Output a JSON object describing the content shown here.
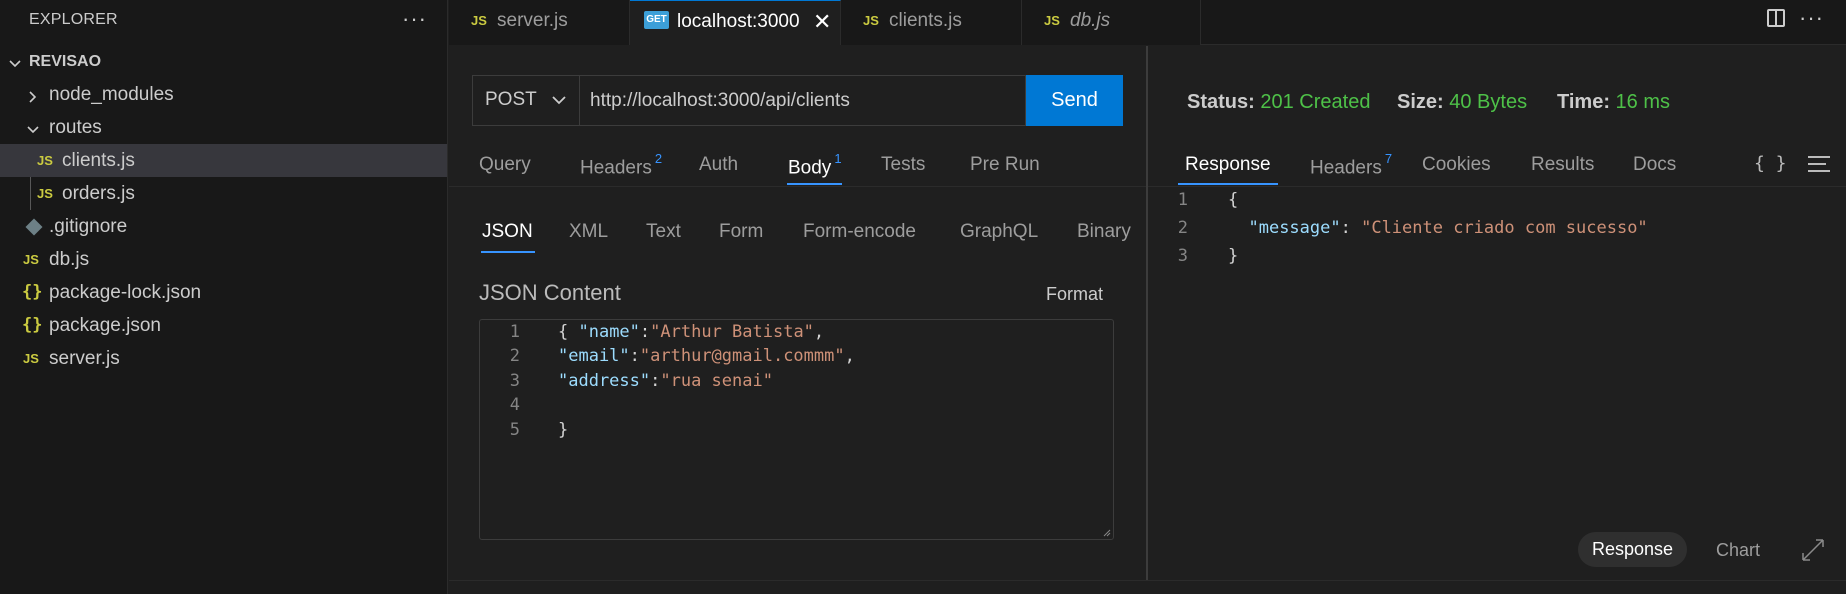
{
  "explorer": {
    "title": "EXPLORER",
    "more_label": "···",
    "root": "REVISAO",
    "items": [
      {
        "label": "node_modules",
        "icon": "chevron-right-icon"
      },
      {
        "label": "routes",
        "icon": "chevron-down-icon"
      },
      {
        "label": "clients.js",
        "icon": "js-icon"
      },
      {
        "label": "orders.js",
        "icon": "js-icon"
      },
      {
        "label": ".gitignore",
        "icon": "git-icon"
      },
      {
        "label": "db.js",
        "icon": "js-icon"
      },
      {
        "label": "package-lock.json",
        "icon": "json-braces-icon"
      },
      {
        "label": "package.json",
        "icon": "json-braces-icon"
      },
      {
        "label": "server.js",
        "icon": "js-icon"
      }
    ],
    "js_badge": "JS",
    "braces_badge": "{}"
  },
  "tabs": [
    {
      "label": "server.js",
      "badge": "JS"
    },
    {
      "label": "localhost:3000",
      "badge": "GET",
      "close": "✕"
    },
    {
      "label": "clients.js",
      "badge": "JS"
    },
    {
      "label": "db.js",
      "badge": "JS"
    }
  ],
  "tab_more": "···",
  "request": {
    "method": "POST",
    "url": "http://localhost:3000/api/clients",
    "send_label": "Send",
    "tabs": [
      {
        "label": "Query"
      },
      {
        "label": "Headers",
        "count": "2"
      },
      {
        "label": "Auth"
      },
      {
        "label": "Body",
        "count": "1"
      },
      {
        "label": "Tests"
      },
      {
        "label": "Pre Run"
      }
    ],
    "body_types": [
      "JSON",
      "XML",
      "Text",
      "Form",
      "Form-encode",
      "GraphQL",
      "Binary"
    ],
    "json_content_label": "JSON Content",
    "format_label": "Format",
    "code_lines": [
      {
        "n": "1",
        "parts": [
          [
            "p",
            "{ "
          ],
          [
            "k",
            "\"name\""
          ],
          [
            "p",
            ":"
          ],
          [
            "s",
            "\"Arthur Batista\""
          ],
          [
            "p",
            ","
          ]
        ]
      },
      {
        "n": "2",
        "parts": [
          [
            "k",
            "\"email\""
          ],
          [
            "p",
            ":"
          ],
          [
            "s",
            "\"arthur@gmail.commm\""
          ],
          [
            "p",
            ","
          ]
        ]
      },
      {
        "n": "3",
        "parts": [
          [
            "k",
            "\"address\""
          ],
          [
            "p",
            ":"
          ],
          [
            "s",
            "\"rua senai\""
          ]
        ]
      },
      {
        "n": "4",
        "parts": []
      },
      {
        "n": "5",
        "parts": [
          [
            "p",
            "}"
          ]
        ]
      }
    ]
  },
  "response": {
    "status_label": "Status:",
    "status_value": "201 Created",
    "size_label": "Size:",
    "size_value": "40 Bytes",
    "time_label": "Time:",
    "time_value": "16 ms",
    "tabs": [
      {
        "label": "Response"
      },
      {
        "label": "Headers",
        "count": "7"
      },
      {
        "label": "Cookies"
      },
      {
        "label": "Results"
      },
      {
        "label": "Docs"
      }
    ],
    "braces_icon_label": "{ }",
    "code_lines": [
      {
        "n": "1",
        "parts": [
          [
            "p",
            "{"
          ]
        ]
      },
      {
        "n": "2",
        "parts": [
          [
            "p",
            "  "
          ],
          [
            "k",
            "\"message\""
          ],
          [
            "p",
            ": "
          ],
          [
            "s",
            "\"Cliente criado com sucesso\""
          ]
        ]
      },
      {
        "n": "3",
        "parts": [
          [
            "p",
            "}"
          ]
        ]
      }
    ],
    "footer_response": "Response",
    "footer_chart": "Chart"
  },
  "colors": {
    "accent": "#0078d4",
    "status_green": "#4ec148",
    "json_key": "#9cdcfe",
    "json_string": "#ce9178",
    "js_badge": "#cbcb41"
  }
}
